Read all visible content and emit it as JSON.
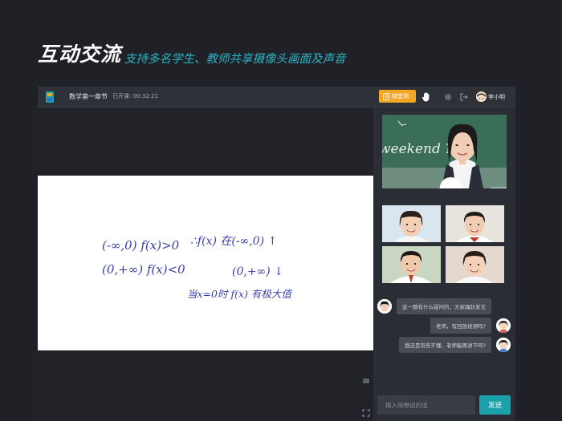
{
  "promo": {
    "title": "互动交流",
    "subtitle": "支持多名学生、教师共享摄像头画面及声音"
  },
  "topbar": {
    "course_title": "数学第一章节",
    "status_label": "已开课:",
    "timer": "00:32:21",
    "quiz_button": "随堂测",
    "user_name": "李小明"
  },
  "whiteboard": {
    "lines": [
      "(-∞,0) f(x)>0",
      "∴f(x) 在(-∞,0) ↑",
      "(0,+∞) f(x)<0",
      "(0,+∞) ↓",
      "当x=0时 f(x) 有极大值"
    ]
  },
  "teacher_video": {
    "board_text": "weekend ?"
  },
  "chat": {
    "messages": [
      {
        "text": "这一题有什么疑问的，大家踊跃发言",
        "side": "left"
      },
      {
        "text": "老师，有回放视频吗?",
        "side": "right"
      },
      {
        "text": "我还是有些不懂，老师能再讲下吗?",
        "side": "right"
      }
    ],
    "input_placeholder": "输入你想说的话",
    "send_label": "发送"
  },
  "colors": {
    "background": "#1f2127",
    "accent_teal": "#1aa1ab",
    "subtitle_teal": "#2bb3c3",
    "quiz_orange": "#f5a623",
    "ink_blue": "#3a3fa8"
  }
}
